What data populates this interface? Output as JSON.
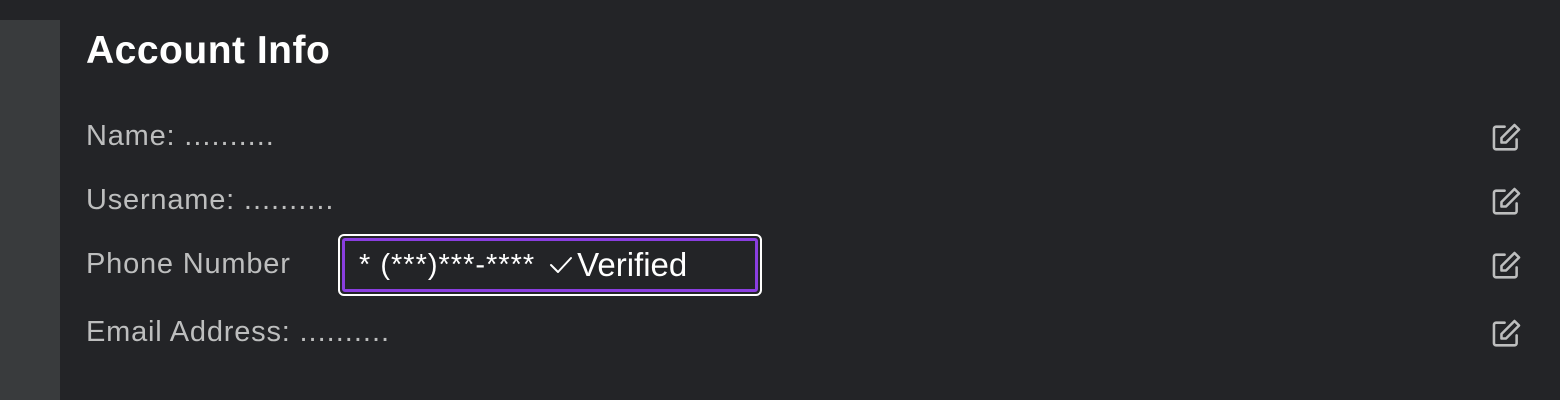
{
  "section": {
    "title": "Account Info"
  },
  "rows": [
    {
      "label": "Name: ",
      "value": "..........",
      "edit_icon": "edit-icon"
    },
    {
      "label": "Username: ",
      "value": "..........",
      "edit_icon": "edit-icon"
    },
    {
      "label": "Phone Number",
      "value": "",
      "edit_icon": "edit-icon"
    },
    {
      "label": "Email Address: ",
      "value": "..........",
      "edit_icon": "edit-icon"
    }
  ],
  "phone": {
    "masked_value": "* (***)***-****",
    "status_label": "Verified",
    "status_icon": "check-icon"
  },
  "colors": {
    "background": "#232427",
    "rail": "#393b3d",
    "label_text": "#bdbebe",
    "title_text": "#ffffff",
    "focus_outline": "#8a3ee0"
  }
}
